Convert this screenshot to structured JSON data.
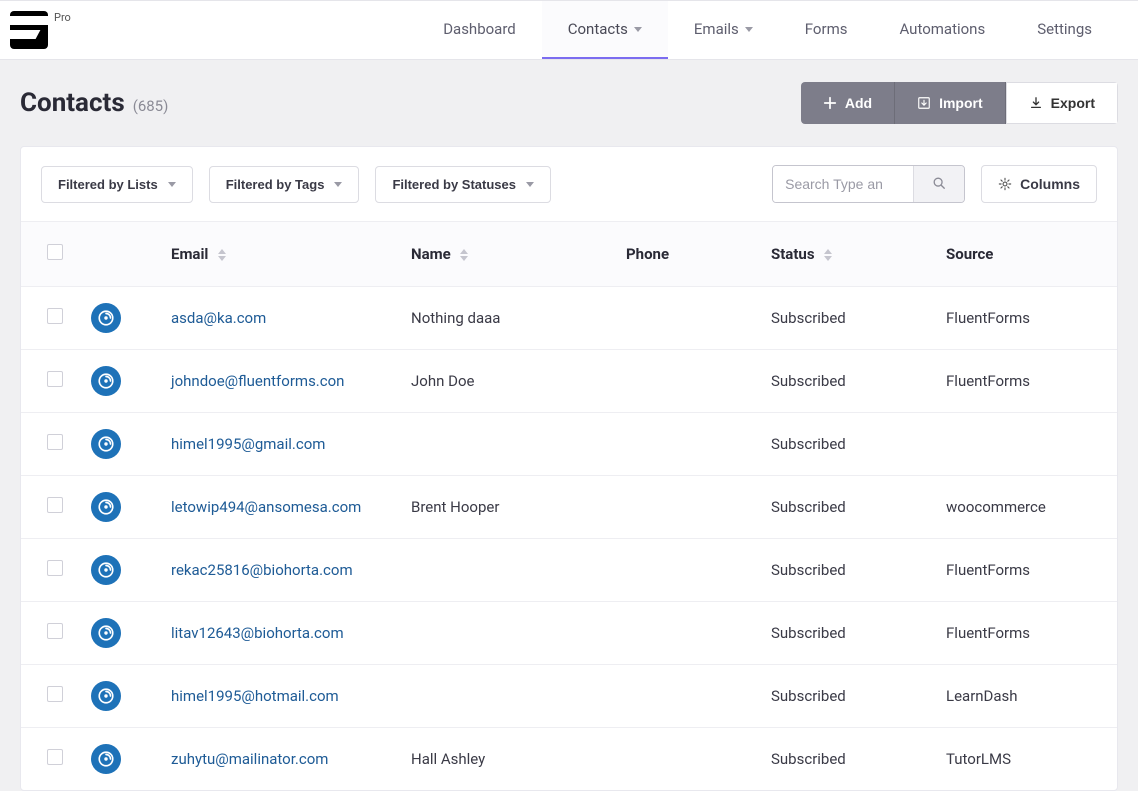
{
  "brand": {
    "pro_label": "Pro"
  },
  "nav": {
    "dashboard": "Dashboard",
    "contacts": "Contacts",
    "emails": "Emails",
    "forms": "Forms",
    "automations": "Automations",
    "settings": "Settings"
  },
  "header": {
    "title": "Contacts",
    "count": "(685)"
  },
  "actions": {
    "add": "Add",
    "import": "Import",
    "export": "Export"
  },
  "filters": {
    "lists": "Filtered by Lists",
    "tags": "Filtered by Tags",
    "statuses": "Filtered by Statuses",
    "columns": "Columns"
  },
  "search": {
    "placeholder": "Search Type an"
  },
  "columns": {
    "email": "Email",
    "name": "Name",
    "phone": "Phone",
    "status": "Status",
    "source": "Source"
  },
  "rows": [
    {
      "email": "asda@ka.com",
      "name": "Nothing daaa",
      "phone": "",
      "status": "Subscribed",
      "source": "FluentForms"
    },
    {
      "email": "johndoe@fluentforms.con",
      "name": "John Doe",
      "phone": "",
      "status": "Subscribed",
      "source": "FluentForms"
    },
    {
      "email": "himel1995@gmail.com",
      "name": "",
      "phone": "",
      "status": "Subscribed",
      "source": ""
    },
    {
      "email": "letowip494@ansomesa.com",
      "name": "Brent Hooper",
      "phone": "",
      "status": "Subscribed",
      "source": "woocommerce"
    },
    {
      "email": "rekac25816@biohorta.com",
      "name": "",
      "phone": "",
      "status": "Subscribed",
      "source": "FluentForms"
    },
    {
      "email": "litav12643@biohorta.com",
      "name": "",
      "phone": "",
      "status": "Subscribed",
      "source": "FluentForms"
    },
    {
      "email": "himel1995@hotmail.com",
      "name": "",
      "phone": "",
      "status": "Subscribed",
      "source": "LearnDash"
    },
    {
      "email": "zuhytu@mailinator.com",
      "name": "Hall Ashley",
      "phone": "",
      "status": "Subscribed",
      "source": "TutorLMS"
    }
  ]
}
